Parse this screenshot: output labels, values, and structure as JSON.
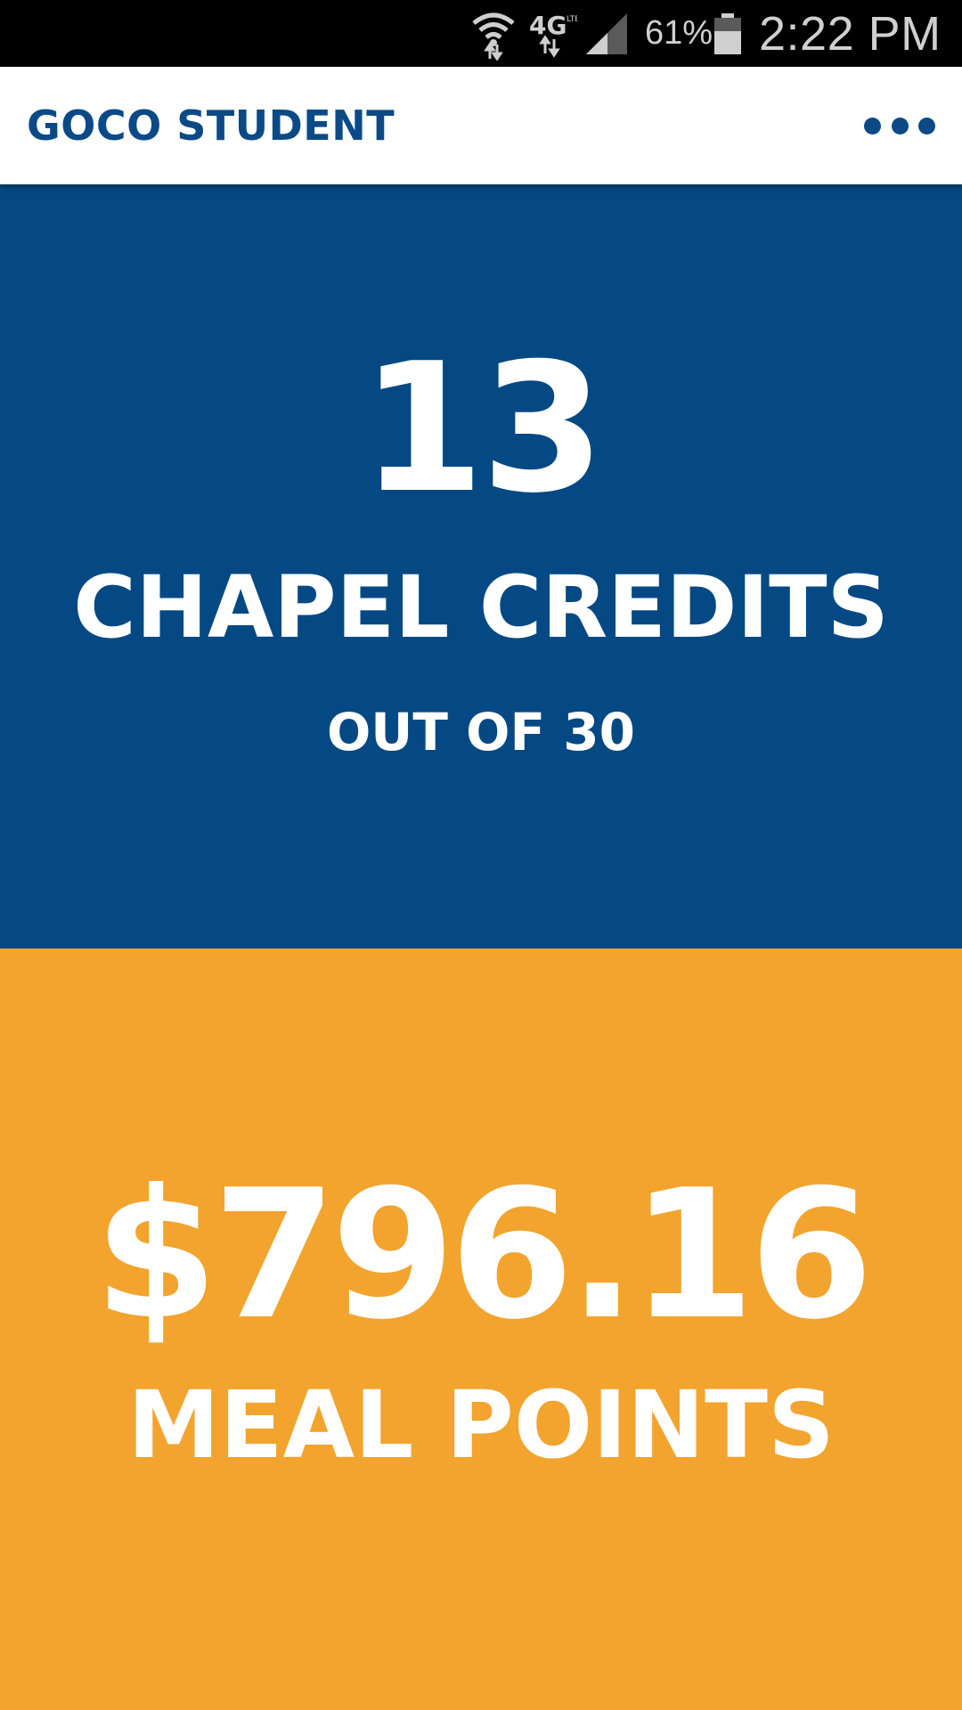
{
  "status_bar": {
    "battery_percent": "61%",
    "time": "2:22 PM",
    "network": "4G",
    "icons": [
      "wifi-icon",
      "4g-lte-icon",
      "signal-icon",
      "battery-icon"
    ]
  },
  "app_bar": {
    "title": "GOCO STUDENT",
    "menu_icon": "more-horizontal-icon"
  },
  "chapel": {
    "count": "13",
    "label": "CHAPEL CREDITS",
    "subtitle": "OUT OF 30"
  },
  "meal": {
    "amount": "$796.16",
    "label": "MEAL POINTS"
  },
  "colors": {
    "brand_blue": "#044983",
    "title_blue": "#0b4a87",
    "meal_orange": "#f2a42e",
    "white": "#ffffff"
  }
}
